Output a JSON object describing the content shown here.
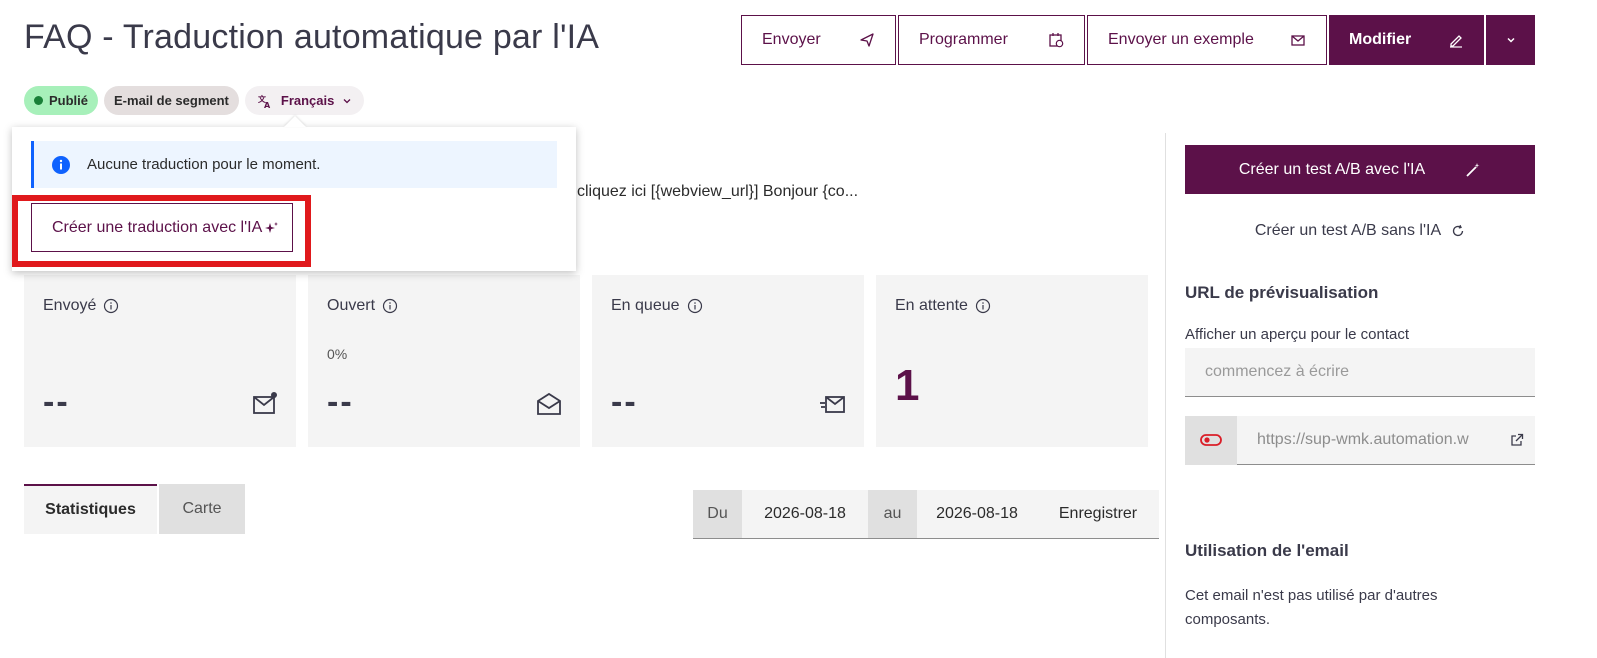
{
  "header": {
    "title": "FAQ - Traduction automatique par l'IA",
    "actions": {
      "send": "Envoyer",
      "schedule": "Programmer",
      "send_sample": "Envoyer un exemple",
      "edit": "Modifier"
    }
  },
  "tags": {
    "status": "Publié",
    "type": "E-mail de segment",
    "language": "Français"
  },
  "translation_popover": {
    "notice": "Aucune traduction pour le moment.",
    "create_button": "Créer une traduction avec l'IA"
  },
  "preview_snippet": "cliquez ici [{webview_url}] Bonjour {co...",
  "stats": [
    {
      "label": "Envoyé",
      "percent": "",
      "value": "--",
      "icon": "mail-notification-icon"
    },
    {
      "label": "Ouvert",
      "percent": "0%",
      "value": "--",
      "icon": "mail-open-icon"
    },
    {
      "label": "En queue",
      "percent": "",
      "value": "--",
      "icon": "mail-send-icon"
    },
    {
      "label": "En attente",
      "percent": "",
      "value": "1",
      "icon": ""
    }
  ],
  "tabs": {
    "stats": "Statistiques",
    "map": "Carte"
  },
  "daterange": {
    "from_label": "Du",
    "from_value": "2026-08-18",
    "to_label": "au",
    "to_value": "2026-08-18",
    "save": "Enregistrer"
  },
  "sidebar": {
    "ab_ai": "Créer un test A/B avec l'IA",
    "ab_no_ai": "Créer un test A/B sans l'IA",
    "preview_heading": "URL de prévisualisation",
    "contact_label": "Afficher un aperçu pour le contact",
    "contact_placeholder": "commencez à écrire",
    "preview_url": "https://sup-wmk.automation.w",
    "usage_heading": "Utilisation de l'email",
    "usage_text": "Cet email n'est pas utilisé par d'autres composants."
  },
  "colors": {
    "brand": "#5c1149",
    "status_green": "#a7f0ba",
    "highlight": "#e0191c",
    "info_blue": "#0f62fe"
  }
}
